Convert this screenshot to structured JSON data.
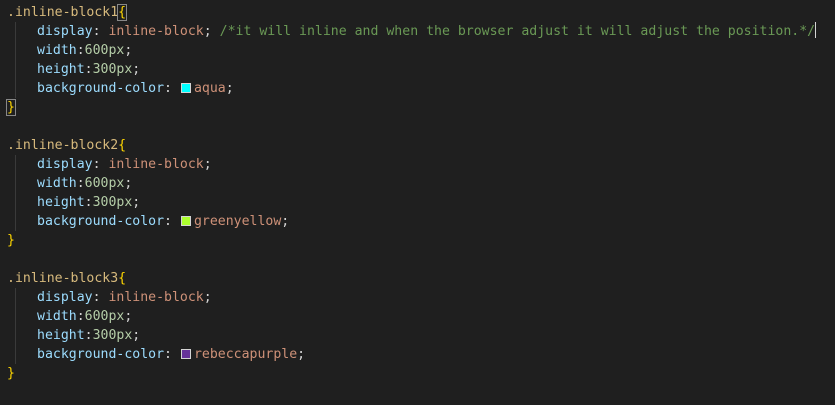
{
  "theme": {
    "background": "#1f1f1f",
    "selector": "#d7ba7d",
    "brace": "#ffd700",
    "property": "#9cdcfe",
    "value": "#ce9178",
    "number": "#b5cea8",
    "comment": "#6a9955"
  },
  "blocks": [
    {
      "selector": ".inline-block1",
      "open": "{",
      "display_prop": "display",
      "display_val": "inline-block",
      "comment": "/*it will inline and when the browser adjust it will adjust the position.*/",
      "width_prop": "width",
      "width_val": "600px",
      "height_prop": "height",
      "height_val": "300px",
      "bg_prop": "background-color",
      "bg_val": "aqua",
      "swatch_color": "#00ffff",
      "close": "}"
    },
    {
      "selector": ".inline-block2",
      "open": "{",
      "display_prop": "display",
      "display_val": "inline-block",
      "width_prop": "width",
      "width_val": "600px",
      "height_prop": "height",
      "height_val": "300px",
      "bg_prop": "background-color",
      "bg_val": "greenyellow",
      "swatch_color": "#adff2f",
      "close": "}"
    },
    {
      "selector": ".inline-block3",
      "open": "{",
      "display_prop": "display",
      "display_val": "inline-block",
      "width_prop": "width",
      "width_val": "600px",
      "height_prop": "height",
      "height_val": "300px",
      "bg_prop": "background-color",
      "bg_val": "rebeccapurple",
      "swatch_color": "#663399",
      "close": "}"
    }
  ]
}
